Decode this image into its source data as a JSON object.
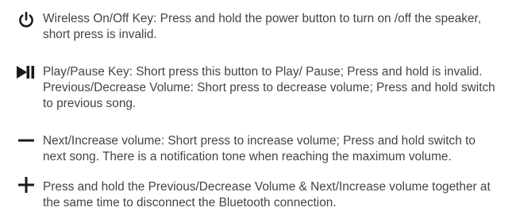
{
  "instructions": [
    {
      "icon": "power-icon",
      "lines": [
        "Wireless  On/Off Key: Press and hold the power button to turn on /off the speaker,",
        "short press is invalid."
      ]
    },
    {
      "icon": "play-pause-icon",
      "lines": [
        "Play/Pause Key: Short press this button to Play/ Pause; Press and hold is invalid.",
        "Previous/Decrease Volume: Short press to decrease volume; Press and hold switch",
        "to previous song."
      ]
    },
    {
      "icon": "minus-icon",
      "lines": [
        "Next/Increase volume:  Short press to increase volume; Press and hold switch to",
        "next song. There is a notification tone when reaching the maximum volume."
      ]
    },
    {
      "icon": "plus-icon",
      "lines": [
        "Press and hold the Previous/Decrease Volume & Next/Increase volume together at",
        "the same time to disconnect the Bluetooth connection."
      ]
    }
  ]
}
